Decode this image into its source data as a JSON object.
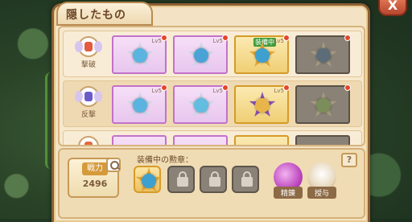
{
  "panel": {
    "title": "隠したもの",
    "close_label": "X"
  },
  "rows": [
    {
      "category": "撃破",
      "slots": [
        {
          "rarity": "purple",
          "lv": "Lv5"
        },
        {
          "rarity": "purple",
          "lv": "Lv5"
        },
        {
          "rarity": "gold",
          "lv": "Lv5",
          "tag": "装備中"
        },
        {
          "rarity": "grey",
          "lv": ""
        }
      ]
    },
    {
      "category": "反撃",
      "slots": [
        {
          "rarity": "purple",
          "lv": "Lv5"
        },
        {
          "rarity": "purple",
          "lv": "Lv5"
        },
        {
          "rarity": "gold",
          "lv": "Lv5"
        },
        {
          "rarity": "grey",
          "lv": ""
        }
      ]
    }
  ],
  "power": {
    "label": "戦力",
    "value": "2496"
  },
  "equipped": {
    "label": "装備中の勲章："
  },
  "buttons": {
    "refine_label": "精錬",
    "gift_label": "授与"
  },
  "help_label": "?"
}
